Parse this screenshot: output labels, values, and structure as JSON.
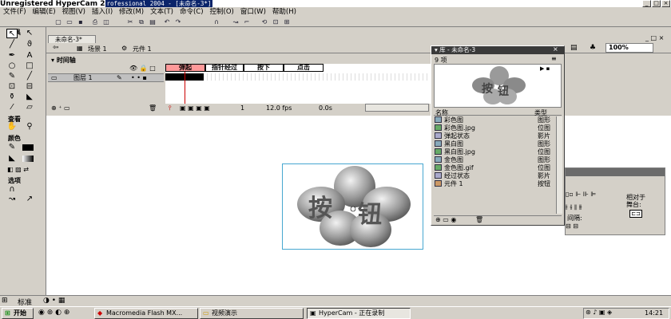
{
  "title_bar": {
    "app": "Unregistered HyperCam 2",
    "doc": "rofessional 2004 - [未命名-3*]"
  },
  "menu": [
    "文件(F)",
    "编辑(E)",
    "视图(V)",
    "插入(I)",
    "修改(M)",
    "文本(T)",
    "命令(C)",
    "控制(O)",
    "窗口(W)",
    "帮助(H)"
  ],
  "tools_panel": {
    "header": "工具",
    "view_label": "查看",
    "color_label": "颜色",
    "options_label": "选项"
  },
  "document": {
    "tab": "未命名-3*",
    "scene": "场景 1",
    "symbol": "元件 1",
    "zoom": "100%"
  },
  "timeline": {
    "header": "时间轴",
    "layer_name": "图层 1",
    "frame_labels": [
      "弹起",
      "指针经过",
      "按下",
      "点击"
    ],
    "current_frame": "1",
    "fps": "12.0 fps",
    "time": "0.0s"
  },
  "library": {
    "title": "库 - 未命名-3",
    "count": "9 项",
    "col_name": "名称",
    "col_type": "类型",
    "items": [
      {
        "name": "彩色图",
        "type": "图形"
      },
      {
        "name": "彩色图.jpg",
        "type": "位图"
      },
      {
        "name": "弹起状态",
        "type": "影片"
      },
      {
        "name": "黑白图",
        "type": "图形"
      },
      {
        "name": "黑白图.jpg",
        "type": "位图"
      },
      {
        "name": "金色图",
        "type": "图形"
      },
      {
        "name": "金色图.gif",
        "type": "位图"
      },
      {
        "name": "经过状态",
        "type": "影片"
      },
      {
        "name": "元件 1",
        "type": "按钮"
      }
    ]
  },
  "align_panel": {
    "relative_label": "相对于\n舞台:",
    "spacing_label": "间隔:"
  },
  "stage_art": {
    "char1": "按",
    "char2": "钮"
  },
  "status_strip": {
    "label": "标准"
  },
  "taskbar": {
    "start": "开始",
    "tasks": [
      "Macromedia Flash MX...",
      "视频演示",
      "HyperCam - 正在录制"
    ],
    "clock": "14:21"
  },
  "colors": {
    "title_bg": "#0a246a",
    "frame_highlight": "#ff9999",
    "playhead": "#cc0000",
    "stage_border": "#47a7d0"
  }
}
